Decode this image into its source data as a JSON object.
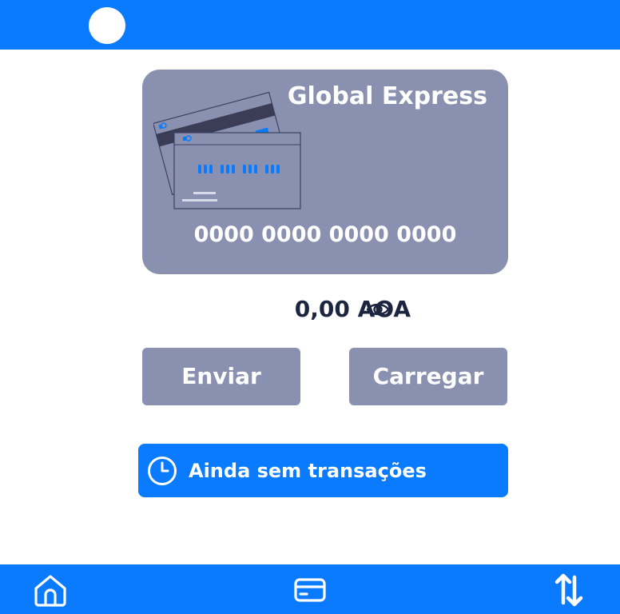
{
  "header": {
    "avatar_icon": "user-avatar"
  },
  "card": {
    "brand": "Global Express",
    "number": "0000 0000 0000 0000",
    "illustration_icon": "credit-cards-illustration"
  },
  "balance": {
    "amount": "0,00 AOA",
    "visibility_icon": "eye-icon"
  },
  "actions": {
    "send_label": "Enviar",
    "load_label": "Carregar"
  },
  "transactions": {
    "empty_message": "Ainda sem transações",
    "icon": "clock-icon"
  },
  "bottom_nav": [
    {
      "icon": "home-icon"
    },
    {
      "icon": "credit-card-icon"
    },
    {
      "icon": "transfer-arrows-icon"
    }
  ],
  "colors": {
    "primary": "#0a7bff",
    "card": "#8990b0",
    "text_dark": "#1b2540",
    "white": "#ffffff"
  }
}
